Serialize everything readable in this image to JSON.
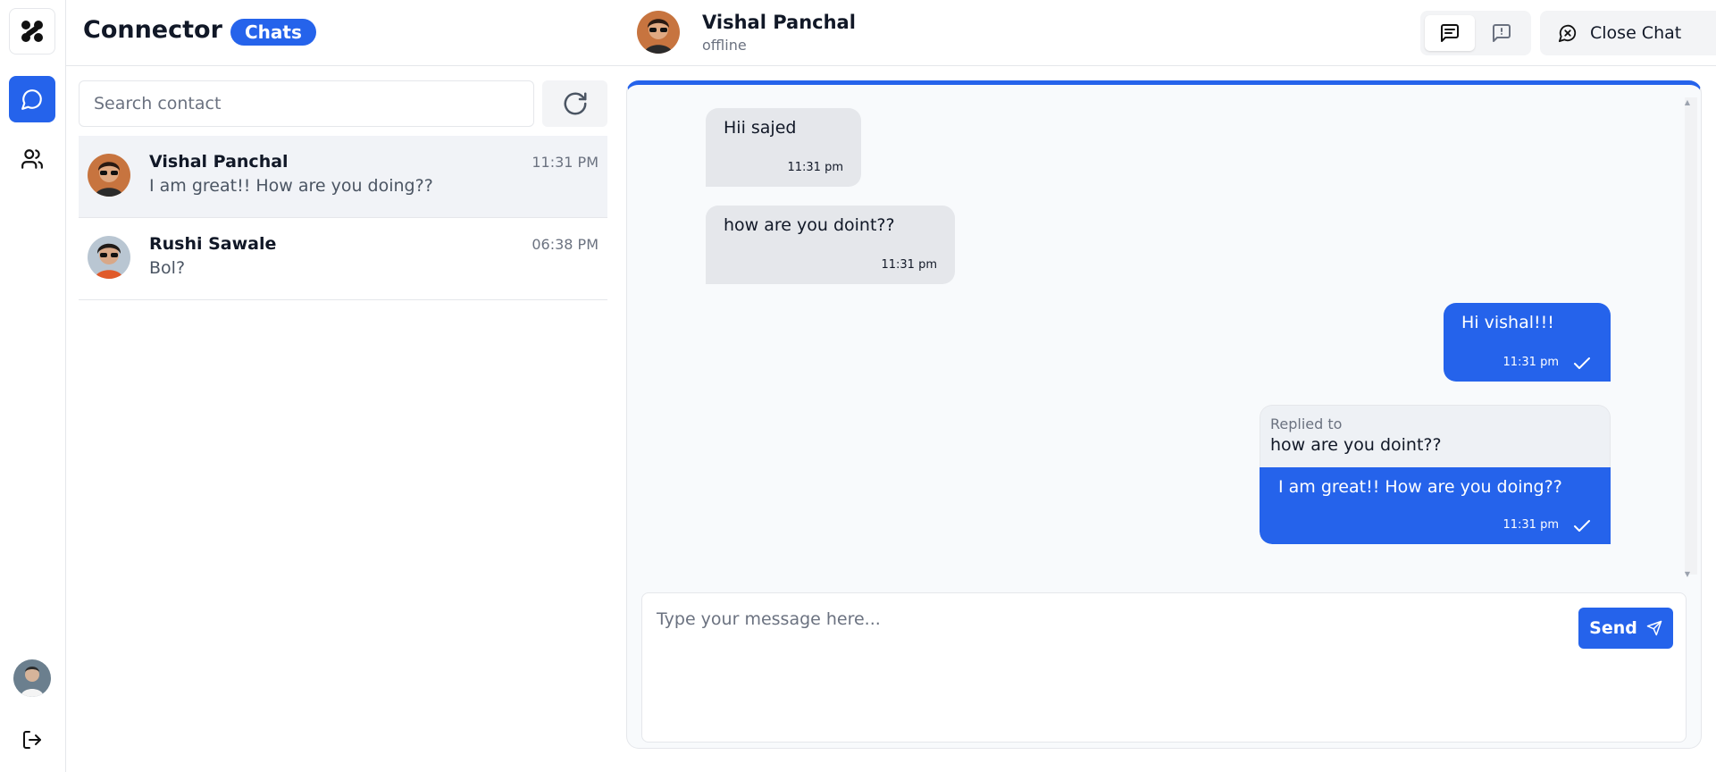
{
  "app": {
    "title": "Connector",
    "badge": "Chats"
  },
  "rail": {
    "icons": [
      "logo-icon",
      "chat-bubble-icon",
      "users-icon",
      "avatar",
      "logout-icon"
    ]
  },
  "chat_header": {
    "name": "Vishal Panchal",
    "status": "offline",
    "close_label": "Close Chat"
  },
  "search": {
    "placeholder": "Search contact",
    "value": ""
  },
  "contacts": [
    {
      "name": "Vishal Panchal",
      "last_message": "I am great!! How are you doing??",
      "time": "11:31 PM",
      "selected": true
    },
    {
      "name": "Rushi Sawale",
      "last_message": "Bol?",
      "time": "06:38 PM",
      "selected": false
    }
  ],
  "messages": [
    {
      "direction": "in",
      "text": "Hii sajed",
      "time": "11:31 pm"
    },
    {
      "direction": "in",
      "text": "how are you doint??",
      "time": "11:31 pm"
    },
    {
      "direction": "out",
      "text": "Hi vishal!!!",
      "time": "11:31 pm"
    },
    {
      "direction": "out",
      "reply_label": "Replied to",
      "reply_text": "how are you doint??",
      "text": "I am great!! How are you doing??",
      "time": "11:31 pm"
    }
  ],
  "composer": {
    "placeholder": "Type your message here...",
    "send_label": "Send"
  },
  "colors": {
    "accent": "#2563eb",
    "incoming_bubble": "#e5e7eb",
    "panel_bg": "#f8fafc"
  }
}
